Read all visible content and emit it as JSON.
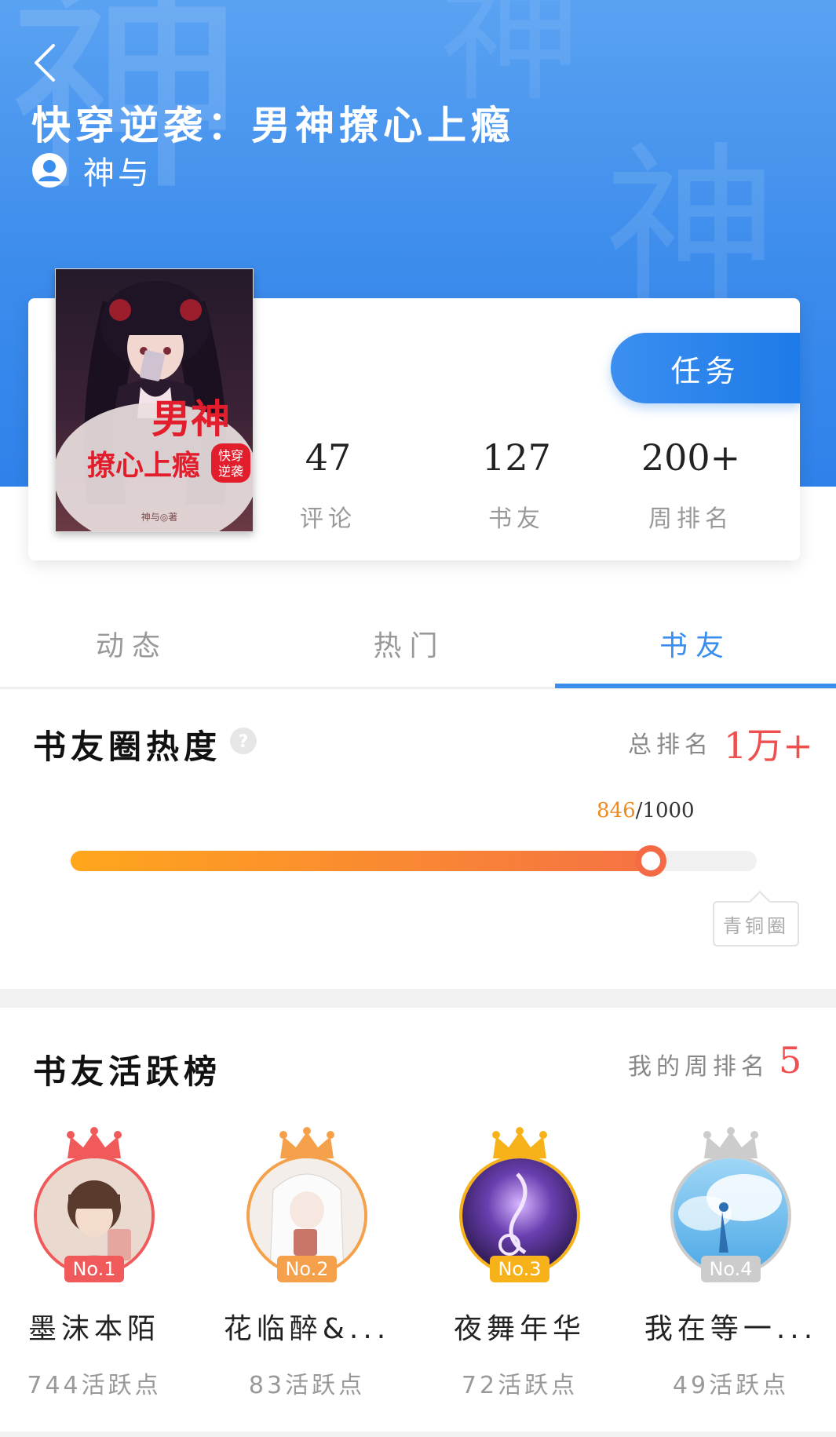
{
  "header": {
    "title": "快穿逆袭：男神撩心上瘾",
    "author": "神与",
    "watermark_char": "神"
  },
  "cover": {
    "title_main": "男神",
    "title_sub": "撩心上瘾",
    "tag": "快穿逆袭",
    "author_line": "神与◎著"
  },
  "task_button": "任务",
  "stats": [
    {
      "value": "47",
      "label": "评论"
    },
    {
      "value": "127",
      "label": "书友"
    },
    {
      "value": "200+",
      "label": "周排名"
    }
  ],
  "tabs": [
    {
      "label": "动态",
      "active": false
    },
    {
      "label": "热门",
      "active": false
    },
    {
      "label": "书友",
      "active": true
    }
  ],
  "heat": {
    "title": "书友圈热度",
    "rank_label": "总排名",
    "rank_value": "1万+",
    "current": "846",
    "max": "1000",
    "level": "青铜圈"
  },
  "ranking": {
    "title": "书友活跃榜",
    "my_rank_label": "我的周排名",
    "my_rank_value": "5",
    "users": [
      {
        "no": "No.1",
        "name": "墨沫本陌",
        "points": "744活跃点"
      },
      {
        "no": "No.2",
        "name": "花临醉&...",
        "points": "83活跃点"
      },
      {
        "no": "No.3",
        "name": "夜舞年华",
        "points": "72活跃点"
      },
      {
        "no": "No.4",
        "name": "我在等一...",
        "points": "49活跃点"
      }
    ]
  },
  "colors": {
    "primary": "#3a8eee",
    "rank_red": "#ef4f4f",
    "progress_start": "#ffa61c",
    "progress_end": "#f57244",
    "no1": "#f05a5a",
    "no2": "#f5a04a",
    "no3": "#f7b21a",
    "no4": "#cccccc"
  }
}
